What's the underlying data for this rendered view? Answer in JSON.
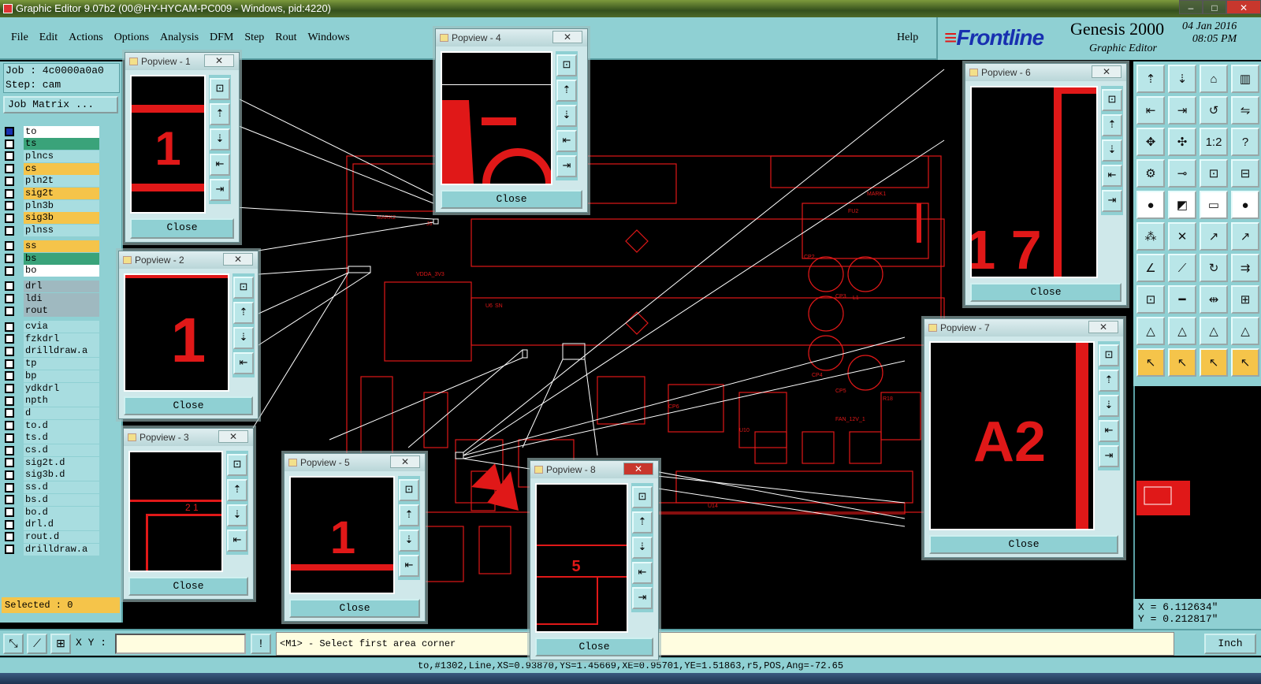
{
  "window": {
    "title": "Graphic Editor 9.07b2 (00@HY-HYCAM-PC009 - Windows, pid:4220)"
  },
  "menu": [
    "File",
    "Edit",
    "Actions",
    "Options",
    "Analysis",
    "DFM",
    "Step",
    "Rout",
    "Windows"
  ],
  "help_label": "Help",
  "brand": {
    "logo": "Frontline",
    "product": "Genesis 2000",
    "subtitle": "Graphic Editor",
    "date": "04 Jan 2016",
    "time": "08:05 PM",
    "logo_color": "#1830b0",
    "stripe_color": "#e01818"
  },
  "job": {
    "job_line": "Job : 4c0000a0a0",
    "step_line": "Step: cam",
    "matrix_label": "Job Matrix ..."
  },
  "layers": [
    {
      "name": "to",
      "color": "#ffffff"
    },
    {
      "name": "ts",
      "color": "#3aa37a"
    },
    {
      "name": "plncs",
      "color": "#a8dde0"
    },
    {
      "name": "cs",
      "color": "#f5c44a"
    },
    {
      "name": "pln2t",
      "color": "#a8dde0"
    },
    {
      "name": "sig2t",
      "color": "#f5c44a"
    },
    {
      "name": "pln3b",
      "color": "#a8dde0"
    },
    {
      "name": "sig3b",
      "color": "#f5c44a"
    },
    {
      "name": "plnss",
      "color": "#a8dde0"
    },
    {
      "name": "ss",
      "color": "#f5c44a"
    },
    {
      "name": "bs",
      "color": "#3aa37a"
    },
    {
      "name": "bo",
      "color": "#ffffff"
    },
    {
      "name": "drl",
      "color": "#9fb9c0"
    },
    {
      "name": "ldi",
      "color": "#9fb9c0"
    },
    {
      "name": "rout",
      "color": "#9fb9c0"
    },
    {
      "name": "cvia",
      "color": "#a8dde0"
    },
    {
      "name": "fzkdrl",
      "color": "#a8dde0"
    },
    {
      "name": "drilldraw.a",
      "color": "#a8dde0"
    },
    {
      "name": "tp",
      "color": "#a8dde0"
    },
    {
      "name": "bp",
      "color": "#a8dde0"
    },
    {
      "name": "ydkdrl",
      "color": "#a8dde0"
    },
    {
      "name": "npth",
      "color": "#a8dde0"
    },
    {
      "name": "d",
      "color": "#a8dde0"
    },
    {
      "name": "to.d",
      "color": "#a8dde0"
    },
    {
      "name": "ts.d",
      "color": "#a8dde0"
    },
    {
      "name": "cs.d",
      "color": "#a8dde0"
    },
    {
      "name": "sig2t.d",
      "color": "#a8dde0"
    },
    {
      "name": "sig3b.d",
      "color": "#a8dde0"
    },
    {
      "name": "ss.d",
      "color": "#a8dde0"
    },
    {
      "name": "bs.d",
      "color": "#a8dde0"
    },
    {
      "name": "bo.d",
      "color": "#a8dde0"
    },
    {
      "name": "drl.d",
      "color": "#a8dde0"
    },
    {
      "name": "rout.d",
      "color": "#a8dde0"
    },
    {
      "name": "drilldraw.a",
      "color": "#a8dde0"
    }
  ],
  "selected_label": "Selected : 0",
  "popviews": [
    {
      "title": "Popview - 1",
      "close": "Close",
      "label": "1"
    },
    {
      "title": "Popview - 2",
      "close": "Close",
      "label": "1"
    },
    {
      "title": "Popview - 3",
      "close": "Close",
      "label": "2 1"
    },
    {
      "title": "Popview - 4",
      "close": "Close",
      "label": ""
    },
    {
      "title": "Popview - 5",
      "close": "Close",
      "label": "1"
    },
    {
      "title": "Popview - 6",
      "close": "Close",
      "label": "1 7"
    },
    {
      "title": "Popview - 7",
      "close": "Close",
      "label": "A2"
    },
    {
      "title": "Popview - 8",
      "close": "Close",
      "label": "5"
    }
  ],
  "command": {
    "xy_label": "X Y :",
    "xy_value": "",
    "prompt": "<M1> - Select first area corner",
    "unit": "Inch"
  },
  "status_line": "to,#1302,Line,XS=0.93870,YS=1.45669,XE=0.95701,YE=1.51863,r5,POS,Ang=-72.65",
  "coords": {
    "x": "X = 6.112634\"",
    "y": "Y = 0.212817\""
  },
  "pcb_labels": [
    "MARK2",
    "VDDA_3V3",
    "U6",
    "SN",
    "MARK1",
    "FU2",
    "CP2",
    "CP3",
    "L1",
    "CP4",
    "CP5",
    "R18",
    "CP6",
    "FAN_12V_1",
    "U10",
    "U14",
    "J6"
  ],
  "colors": {
    "panel": "#8fd0d3",
    "trace": "#e01818",
    "accent": "#f5c44a"
  }
}
